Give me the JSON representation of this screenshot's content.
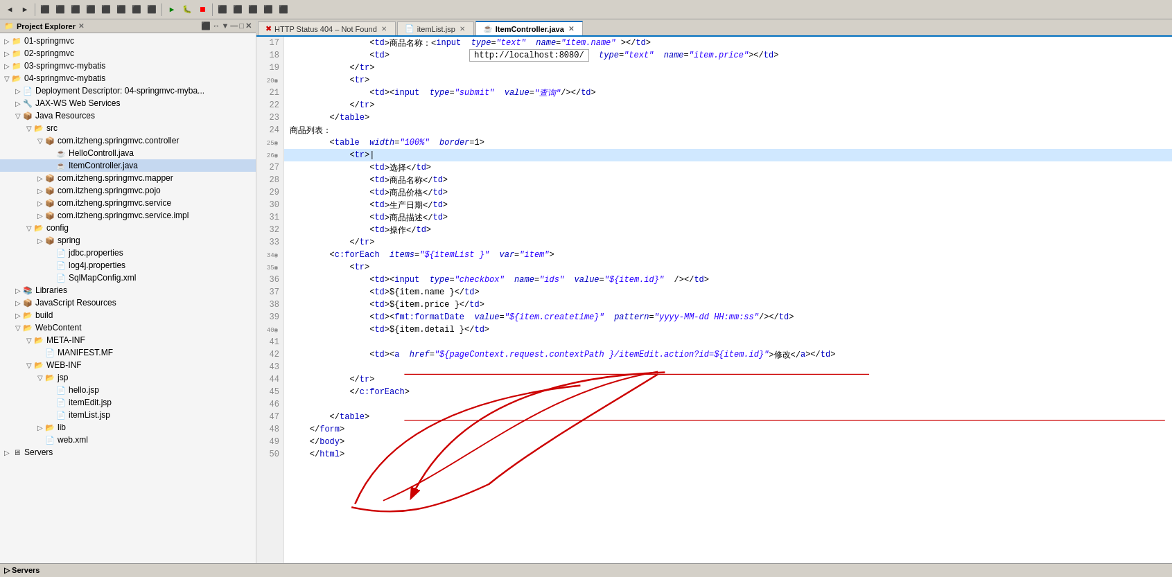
{
  "toolbar": {
    "icons": [
      "◀",
      "▶",
      "⏸",
      "⏹",
      "⏭",
      "🔧",
      "🔍",
      "📋",
      "✂",
      "📄",
      "💾",
      "🖨",
      "🔙",
      "🔜",
      "🔛",
      "◀◀",
      "▶▶"
    ]
  },
  "sidebar": {
    "title": "Project Explorer",
    "close_icon": "✕",
    "header_icons": [
      "⬛",
      "↕",
      "▭",
      "✕"
    ],
    "tree": [
      {
        "id": "01-springmvc",
        "label": "01-springmvc",
        "indent": 0,
        "type": "project",
        "expanded": false
      },
      {
        "id": "02-springmvc",
        "label": "02-springmvc",
        "indent": 0,
        "type": "project",
        "expanded": false
      },
      {
        "id": "03-springmvc-mybatis",
        "label": "03-springmvc-mybatis",
        "indent": 0,
        "type": "project",
        "expanded": false
      },
      {
        "id": "04-springmvc-mybatis",
        "label": "04-springmvc-mybatis",
        "indent": 0,
        "type": "project",
        "expanded": true
      },
      {
        "id": "deployment-descriptor",
        "label": "Deployment Descriptor: 04-springmvc-myba...",
        "indent": 1,
        "type": "descriptor",
        "expanded": false
      },
      {
        "id": "jax-ws",
        "label": "JAX-WS Web Services",
        "indent": 1,
        "type": "jaxws",
        "expanded": false
      },
      {
        "id": "java-resources",
        "label": "Java Resources",
        "indent": 1,
        "type": "java",
        "expanded": true
      },
      {
        "id": "src",
        "label": "src",
        "indent": 2,
        "type": "folder",
        "expanded": true
      },
      {
        "id": "com.itzheng.springmvc.controller",
        "label": "com.itzheng.springmvc.controller",
        "indent": 3,
        "type": "package",
        "expanded": true
      },
      {
        "id": "HelloControll.java",
        "label": "HelloControll.java",
        "indent": 4,
        "type": "java",
        "expanded": false
      },
      {
        "id": "ItemController.java",
        "label": "ItemController.java",
        "indent": 4,
        "type": "java",
        "expanded": false,
        "selected": true
      },
      {
        "id": "com.itzheng.springmvc.mapper",
        "label": "com.itzheng.springmvc.mapper",
        "indent": 3,
        "type": "package",
        "expanded": false
      },
      {
        "id": "com.itzheng.springmvc.pojo",
        "label": "com.itzheng.springmvc.pojo",
        "indent": 3,
        "type": "package",
        "expanded": false
      },
      {
        "id": "com.itzheng.springmvc.service",
        "label": "com.itzheng.springmvc.service",
        "indent": 3,
        "type": "package",
        "expanded": false
      },
      {
        "id": "com.itzheng.springmvc.service.impl",
        "label": "com.itzheng.springmvc.service.impl",
        "indent": 3,
        "type": "package",
        "expanded": false
      },
      {
        "id": "config",
        "label": "config",
        "indent": 2,
        "type": "folder",
        "expanded": true
      },
      {
        "id": "spring",
        "label": "spring",
        "indent": 3,
        "type": "package",
        "expanded": false
      },
      {
        "id": "jdbc.properties",
        "label": "jdbc.properties",
        "indent": 3,
        "type": "properties",
        "expanded": false
      },
      {
        "id": "log4j.properties",
        "label": "log4j.properties",
        "indent": 3,
        "type": "properties",
        "expanded": false
      },
      {
        "id": "SqlMapConfig.xml",
        "label": "SqlMapConfig.xml",
        "indent": 3,
        "type": "xml",
        "expanded": false
      },
      {
        "id": "Libraries",
        "label": "Libraries",
        "indent": 1,
        "type": "libraries",
        "expanded": false
      },
      {
        "id": "JavaScript Resources",
        "label": "JavaScript Resources",
        "indent": 1,
        "type": "js",
        "expanded": false
      },
      {
        "id": "build",
        "label": "build",
        "indent": 1,
        "type": "folder",
        "expanded": false
      },
      {
        "id": "WebContent",
        "label": "WebContent",
        "indent": 1,
        "type": "folder",
        "expanded": true
      },
      {
        "id": "META-INF",
        "label": "META-INF",
        "indent": 2,
        "type": "folder",
        "expanded": true
      },
      {
        "id": "MANIFEST.MF",
        "label": "MANIFEST.MF",
        "indent": 3,
        "type": "file",
        "expanded": false
      },
      {
        "id": "WEB-INF",
        "label": "WEB-INF",
        "indent": 2,
        "type": "folder",
        "expanded": true
      },
      {
        "id": "jsp",
        "label": "jsp",
        "indent": 3,
        "type": "folder",
        "expanded": true
      },
      {
        "id": "hello.jsp",
        "label": "hello.jsp",
        "indent": 4,
        "type": "jsp",
        "expanded": false
      },
      {
        "id": "itemEdit.jsp",
        "label": "itemEdit.jsp",
        "indent": 4,
        "type": "jsp",
        "expanded": false
      },
      {
        "id": "itemList.jsp",
        "label": "itemList.jsp",
        "indent": 4,
        "type": "jsp",
        "expanded": false,
        "selected_alt": true
      },
      {
        "id": "lib",
        "label": "lib",
        "indent": 3,
        "type": "folder",
        "expanded": false
      },
      {
        "id": "web.xml",
        "label": "web.xml",
        "indent": 3,
        "type": "xml",
        "expanded": false
      },
      {
        "id": "Servers",
        "label": "Servers",
        "indent": 0,
        "type": "servers",
        "expanded": false
      }
    ]
  },
  "tabs": [
    {
      "label": "HTTP Status 404 – Not Found",
      "active": false,
      "icon": "🌐"
    },
    {
      "label": "itemList.jsp",
      "active": false,
      "icon": "📄"
    },
    {
      "label": "ItemController.java",
      "active": true,
      "icon": "☕"
    }
  ],
  "code": {
    "lines": [
      {
        "num": 17,
        "fold": false,
        "content": "                <td>商品名称：<input  type=\"text\" name=\"item.name\" ></td>"
      },
      {
        "num": 18,
        "fold": false,
        "content": "                <td>              http://localhost:8080/      type=\"text\" name=\"item.price\"></td>",
        "tooltip": true,
        "tooltip_text": "http://localhost:8080/"
      },
      {
        "num": 19,
        "fold": false,
        "content": "            </tr>"
      },
      {
        "num": 20,
        "fold": true,
        "content": "            <tr>"
      },
      {
        "num": 21,
        "fold": false,
        "content": "                <td><input  type=\"submit\"  value=\"查询\"/></td>"
      },
      {
        "num": 22,
        "fold": false,
        "content": "            </tr>"
      },
      {
        "num": 23,
        "fold": false,
        "content": "        </table>"
      },
      {
        "num": 24,
        "fold": false,
        "content": "商品列表："
      },
      {
        "num": 25,
        "fold": true,
        "content": "        <table width=\"100%\" border=1>"
      },
      {
        "num": 26,
        "fold": true,
        "content": "            <tr>",
        "highlighted": true
      },
      {
        "num": 27,
        "fold": false,
        "content": "                <td>选择</td>"
      },
      {
        "num": 28,
        "fold": false,
        "content": "                <td>商品名称</td>"
      },
      {
        "num": 29,
        "fold": false,
        "content": "                <td>商品价格</td>"
      },
      {
        "num": 30,
        "fold": false,
        "content": "                <td>生产日期</td>"
      },
      {
        "num": 31,
        "fold": false,
        "content": "                <td>商品描述</td>"
      },
      {
        "num": 32,
        "fold": false,
        "content": "                <td>操作</td>"
      },
      {
        "num": 33,
        "fold": false,
        "content": "            </tr>"
      },
      {
        "num": 34,
        "fold": true,
        "content": "        <c:forEach items=\"${itemList }\"  var=\"item\">"
      },
      {
        "num": 35,
        "fold": true,
        "content": "            <tr>"
      },
      {
        "num": 36,
        "fold": false,
        "content": "                <td><input  type=\"checkbox\"  name=\"ids\"  value=\"${item.id}\"  /></td>"
      },
      {
        "num": 37,
        "fold": false,
        "content": "                <td>${item.name }</td>"
      },
      {
        "num": 38,
        "fold": false,
        "content": "                <td>${item.price }</td>"
      },
      {
        "num": 39,
        "fold": false,
        "content": "                <td><fmt:formatDate  value=\"${item.createtime}\"  pattern=\"yyyy-MM-dd HH:mm:ss\"/></td>"
      },
      {
        "num": 40,
        "fold": true,
        "content": "                <td>${item.detail }</td>"
      },
      {
        "num": 41,
        "fold": false,
        "content": ""
      },
      {
        "num": 42,
        "fold": false,
        "content": "                <td><a href=\"${pageContext.request.contextPath }/itemEdit.action?id=${item.id}\">修改</a></td>"
      },
      {
        "num": 43,
        "fold": false,
        "content": ""
      },
      {
        "num": 44,
        "fold": false,
        "content": "            </tr>"
      },
      {
        "num": 45,
        "fold": false,
        "content": "            </c:forEach>"
      },
      {
        "num": 46,
        "fold": false,
        "content": ""
      },
      {
        "num": 47,
        "fold": false,
        "content": "        </table>"
      },
      {
        "num": 48,
        "fold": false,
        "content": "    </form>"
      },
      {
        "num": 49,
        "fold": false,
        "content": "    </body>"
      },
      {
        "num": 50,
        "fold": false,
        "content": "    </html>"
      }
    ]
  }
}
